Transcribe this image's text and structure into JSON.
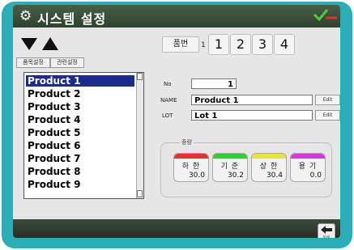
{
  "window": {
    "title": "시스템 설정",
    "title_icon": "gear-icon"
  },
  "pager": {
    "label": "품번",
    "current": "1",
    "pages": [
      "1",
      "2",
      "3",
      "4"
    ],
    "prev_icon": "triangle-down-icon",
    "next_icon": "triangle-up-icon"
  },
  "tabs": [
    "품목설정",
    "관련설정"
  ],
  "product_list": {
    "items": [
      "Product 1",
      "Product 2",
      "Product 3",
      "Product 4",
      "Product 5",
      "Product 6",
      "Product 7",
      "Product 8",
      "Product 9"
    ],
    "selected": "Product 1"
  },
  "form": {
    "no_label": "No",
    "no_value": "1",
    "name_label": "NAME",
    "name_value": "Product 1",
    "name_edit_label": "Edit",
    "lot_label": "LOT",
    "lot_value": "Lot 1",
    "lot_edit_label": "Edit"
  },
  "weight": {
    "title": "중량",
    "buttons": [
      {
        "label": "하 한",
        "value": "30.0",
        "color": "#e83030"
      },
      {
        "label": "기 준",
        "value": "30.2",
        "color": "#33cc33"
      },
      {
        "label": "상 한",
        "value": "30.4",
        "color": "#e6e633"
      },
      {
        "label": "용 기",
        "value": "0.0",
        "color": "#dd33dd"
      }
    ]
  },
  "bottom": {
    "back_label": "뒤로",
    "back_icon": "back-arrow-icon"
  },
  "colors": {
    "device": "#27aeb7",
    "titlebar": "#3a503a",
    "selection": "#1c2b8c"
  }
}
